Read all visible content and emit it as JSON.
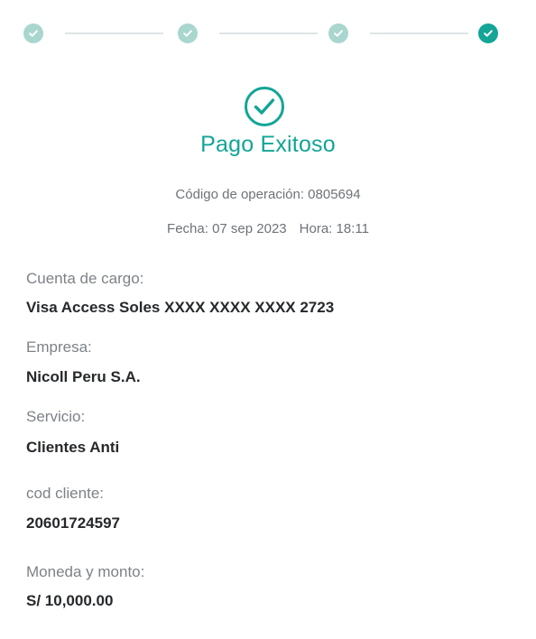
{
  "header": {
    "steps": [
      {
        "icon": "check-icon",
        "state": "done"
      },
      {
        "icon": "check-icon",
        "state": "done"
      },
      {
        "icon": "check-icon",
        "state": "done"
      },
      {
        "icon": "check-icon",
        "state": "current"
      }
    ]
  },
  "result": {
    "icon": "check-circle-icon",
    "title": "Pago Exitoso",
    "operation_code": "Código de operación: 0805694",
    "date": "Fecha: 07 sep 2023",
    "time": "Hora: 18:11"
  },
  "details": {
    "account_label": "Cuenta de cargo:",
    "account_value": "Visa Access Soles XXXX XXXX XXXX 2723",
    "company_label": "Empresa:",
    "company_value": "Nicoll Peru S.A.",
    "service_label": "Servicio:",
    "service_value": "Clientes Anti",
    "client_code_label": "cod cliente:",
    "client_code_value": "20601724597",
    "amount_label": "Moneda y monto:",
    "amount_value": "S/ 10,000.00"
  },
  "colors": {
    "accent": "#13a596",
    "step_done": "#a9d6cf",
    "text_primary": "#26292c",
    "text_secondary": "#7d8287"
  }
}
